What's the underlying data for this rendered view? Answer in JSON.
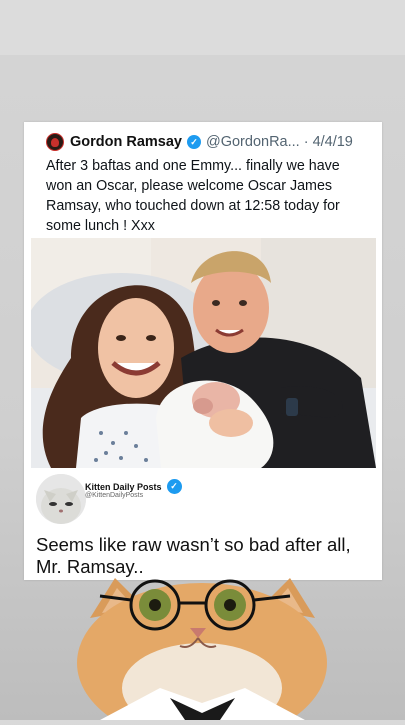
{
  "tweet": {
    "author_name": "Gordon Ramsay",
    "author_handle": "@GordonRa...",
    "separator": "·",
    "date": "4/4/19",
    "text": "After 3 baftas and one Emmy... finally we have won an Oscar, please welcome Oscar James Ramsay, who touched down at 12:58 today for some lunch ! Xxx",
    "verified_icon": "verified-badge-icon",
    "logo_icon": "gordon-ramsay-logo-icon"
  },
  "reply": {
    "author_name": "Kitten Daily Posts",
    "author_handle": "@KittenDailyPosts",
    "text": "Seems like raw wasn’t so bad after all, Mr. Ramsay.."
  },
  "colors": {
    "verified_blue": "#1d9bf0",
    "handle_gray": "#536471",
    "logo_red": "#c9302c"
  }
}
